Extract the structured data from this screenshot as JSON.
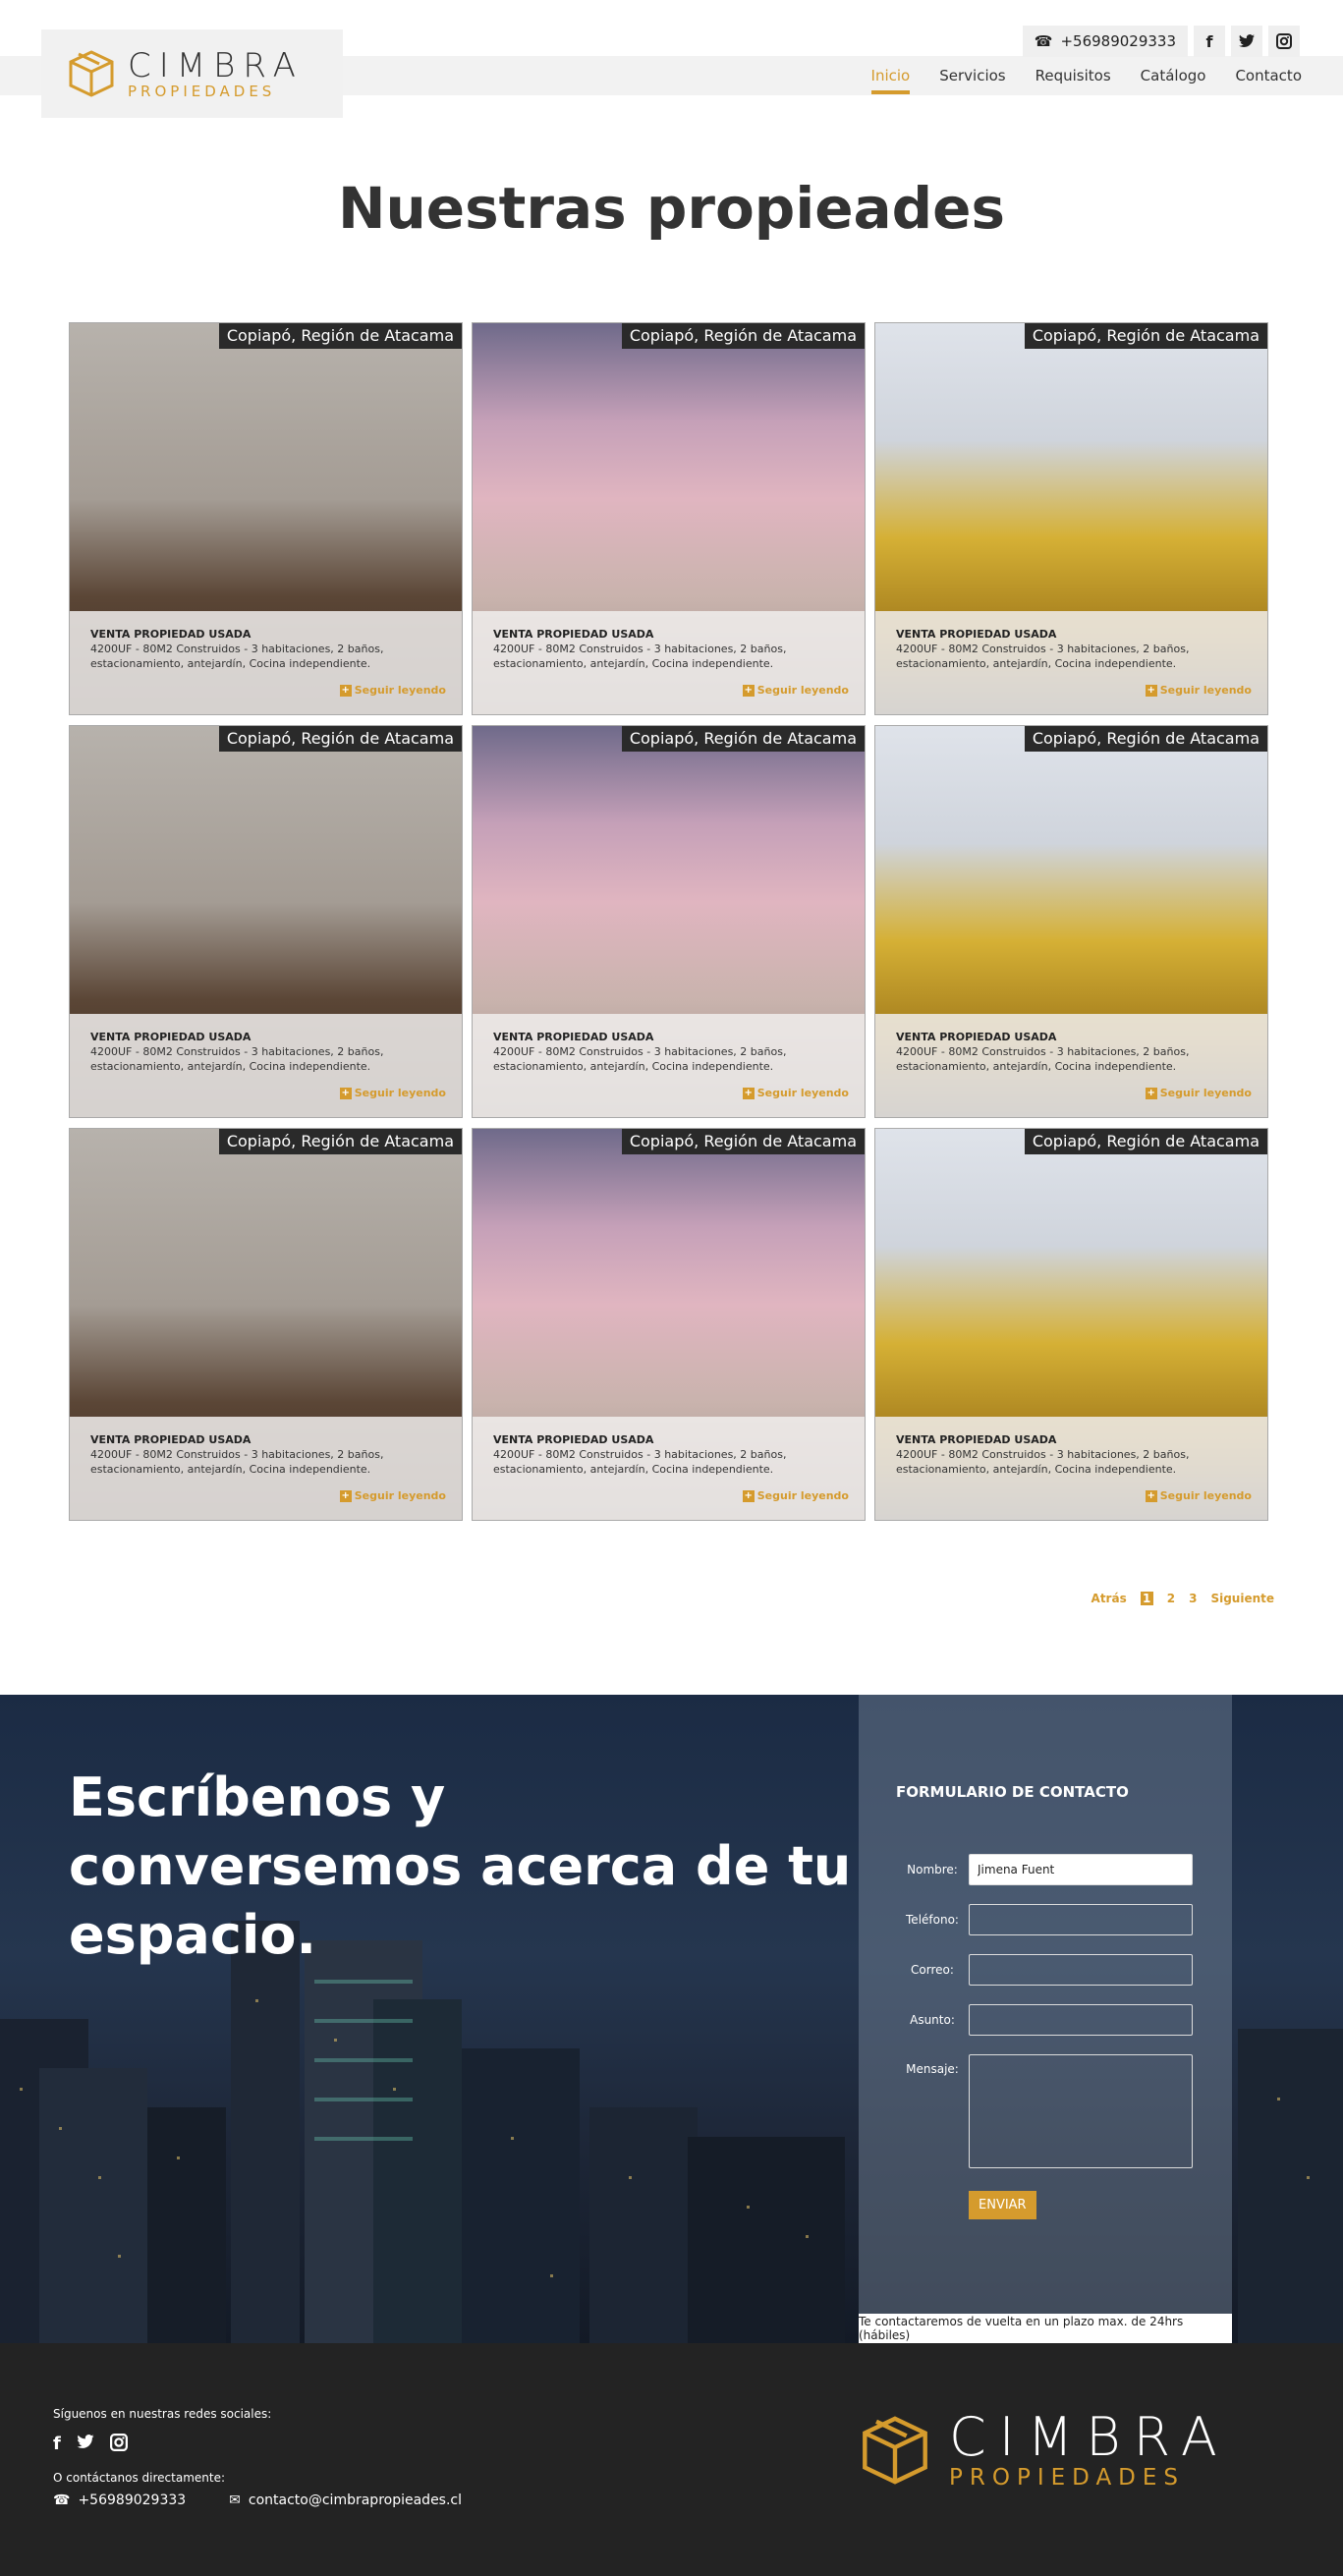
{
  "header": {
    "phone": "+56989029333",
    "logo_main": "CIMBRA",
    "logo_sub": "PROPIEDADES",
    "nav": [
      "Inicio",
      "Servicios",
      "Requisitos",
      "Catálogo",
      "Contacto"
    ],
    "active_nav": "Inicio",
    "accent": "#d59b2d"
  },
  "main": {
    "title": "Nuestras propieades",
    "cards": [
      {
        "location": "Copiapó, Región de Atacama",
        "type": "VENTA PROPIEDAD USADA",
        "desc": "4200UF - 80M2 Construidos  -  3 habitaciones, 2 baños, estacionamiento, antejardín, Cocina independiente.",
        "more": "Seguir leyendo",
        "scene": "dining"
      },
      {
        "location": "Copiapó, Región de Atacama",
        "type": "VENTA PROPIEDAD USADA",
        "desc": "4200UF - 80M2 Construidos  -  3 habitaciones, 2 baños, estacionamiento, antejardín, Cocina independiente.",
        "more": "Seguir leyendo",
        "scene": "building"
      },
      {
        "location": "Copiapó, Región de Atacama",
        "type": "VENTA PROPIEDAD USADA",
        "desc": "4200UF - 80M2 Construidos  -  3 habitaciones, 2 baños, estacionamiento, antejardín, Cocina independiente.",
        "more": "Seguir leyendo",
        "scene": "house"
      },
      {
        "location": "Copiapó, Región de Atacama",
        "type": "VENTA PROPIEDAD USADA",
        "desc": "4200UF - 80M2 Construidos  -  3 habitaciones, 2 baños, estacionamiento, antejardín, Cocina independiente.",
        "more": "Seguir leyendo",
        "scene": "dining"
      },
      {
        "location": "Copiapó, Región de Atacama",
        "type": "VENTA PROPIEDAD USADA",
        "desc": "4200UF - 80M2 Construidos  -  3 habitaciones, 2 baños, estacionamiento, antejardín, Cocina independiente.",
        "more": "Seguir leyendo",
        "scene": "building"
      },
      {
        "location": "Copiapó, Región de Atacama",
        "type": "VENTA PROPIEDAD USADA",
        "desc": "4200UF - 80M2 Construidos  -  3 habitaciones, 2 baños, estacionamiento, antejardín, Cocina independiente.",
        "more": "Seguir leyendo",
        "scene": "house"
      },
      {
        "location": "Copiapó, Región de Atacama",
        "type": "VENTA PROPIEDAD USADA",
        "desc": "4200UF - 80M2 Construidos  -  3 habitaciones, 2 baños, estacionamiento, antejardín, Cocina independiente.",
        "more": "Seguir leyendo",
        "scene": "dining"
      },
      {
        "location": "Copiapó, Región de Atacama",
        "type": "VENTA PROPIEDAD USADA",
        "desc": "4200UF - 80M2 Construidos  -  3 habitaciones, 2 baños, estacionamiento, antejardín, Cocina independiente.",
        "more": "Seguir leyendo",
        "scene": "building"
      },
      {
        "location": "Copiapó, Región de Atacama",
        "type": "VENTA PROPIEDAD USADA",
        "desc": "4200UF - 80M2 Construidos  -  3 habitaciones, 2 baños, estacionamiento, antejardín, Cocina independiente.",
        "more": "Seguir leyendo",
        "scene": "house"
      }
    ]
  },
  "pager": {
    "prev": "Atrás",
    "pages": [
      "1",
      "2",
      "3"
    ],
    "current": "1",
    "next": "Siguiente"
  },
  "contact": {
    "headline": "Escríbenos y conversemos acerca de tu espacio.",
    "form_title": "FORMULARIO DE CONTACTO",
    "fields": {
      "name_label": "Nombre:",
      "name_value": "Jimena Fuent",
      "phone_label": "Teléfono:",
      "email_label": "Correo:",
      "subject_label": "Asunto:",
      "message_label": "Mensaje:"
    },
    "submit": "ENVIAR",
    "note": "Te contactaremos de vuelta en un plazo max. de 24hrs (hábiles)"
  },
  "footer": {
    "follow": "Síguenos en nuestras redes sociales:",
    "direct": "O contáctanos directamente:",
    "phone": "+56989029333",
    "email": "contacto@cimbrapropieades.cl",
    "logo_main": "CIMBRA",
    "logo_sub": "PROPIEDADES"
  }
}
